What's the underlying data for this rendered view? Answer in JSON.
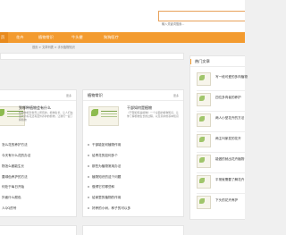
{
  "header": {
    "search_placeholder": "输入关键词搜索..."
  },
  "nav": {
    "items": [
      {
        "label": "页",
        "active": true
      },
      {
        "label": "花卉",
        "active": false
      },
      {
        "label": "植物常识",
        "active": false
      },
      {
        "label": "牛头梗",
        "active": false
      },
      {
        "label": "狗狗医疗",
        "active": false
      }
    ]
  },
  "breadcrumb": "首页 > 文章列表 > 手头植物知识",
  "left_card": {
    "title": "",
    "more": "更多",
    "featured": {
      "title": "到哪种植物会有什么",
      "desc": "植物种植到世界上所有的，植物生长，让人们在室内养好花还有室外养护的植物，让我们一起了解植物"
    },
    "list": [
      "怎么花的养护方法",
      "今天有什么花的办法",
      "物怎么都能生长",
      "要绿色养护的方法",
      "何处于每日开始",
      "外面什么颜色",
      "人QQ的号"
    ]
  },
  "middle_card": {
    "title": "植物常识",
    "more": "更多",
    "featured": {
      "title": "干部如何是植物",
      "desc": "《干部如何是植物》一个全面的植物知识，让你了解植物生长的过程，以及养护的基本知识"
    },
    "list": [
      "干部能如何植物作用",
      "给青花的如何多个",
      "那些为植物常用办法",
      "植物知识的这个问题",
      "做得它们哪些和",
      "给家里的植物的作用",
      "好养的小树，种子的可以多"
    ]
  },
  "right_card": {
    "title": "热门文章",
    "items": [
      "写一段可爱的多肉植物",
      "四位多肉者的养护",
      "两人小型花卉的方法",
      "两主叫家发的花卉",
      "能做的就出花卉植物",
      "平常就需要了解花卉",
      "下头的花卉养护"
    ]
  }
}
